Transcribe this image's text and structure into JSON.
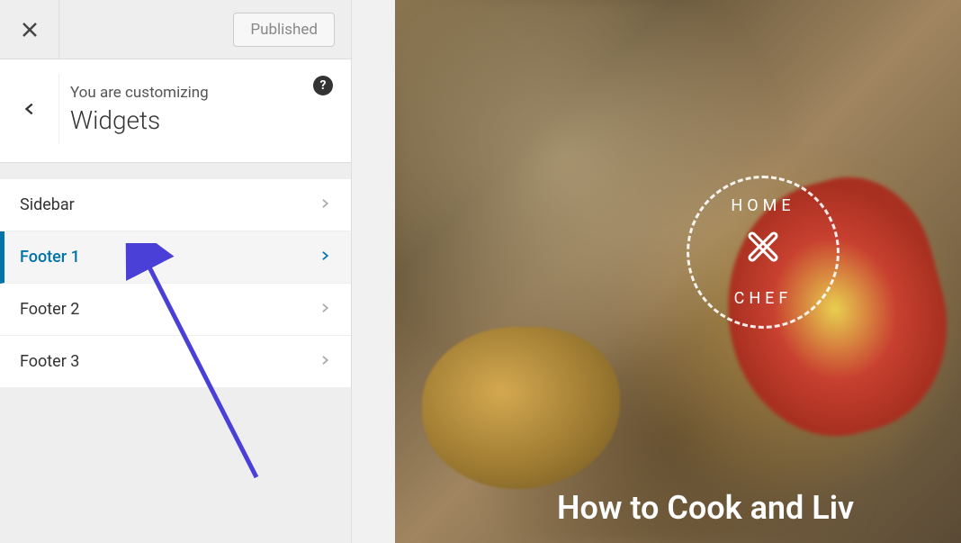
{
  "topbar": {
    "publish_label": "Published"
  },
  "header": {
    "customizing_label": "You are customizing",
    "section_title": "Widgets"
  },
  "widgets": {
    "items": [
      {
        "label": "Sidebar",
        "active": false
      },
      {
        "label": "Footer 1",
        "active": true
      },
      {
        "label": "Footer 2",
        "active": false
      },
      {
        "label": "Footer 3",
        "active": false
      }
    ]
  },
  "preview": {
    "logo_top": "HOME",
    "logo_bottom": "CHEF",
    "hero_title": "How to Cook and Liv"
  }
}
